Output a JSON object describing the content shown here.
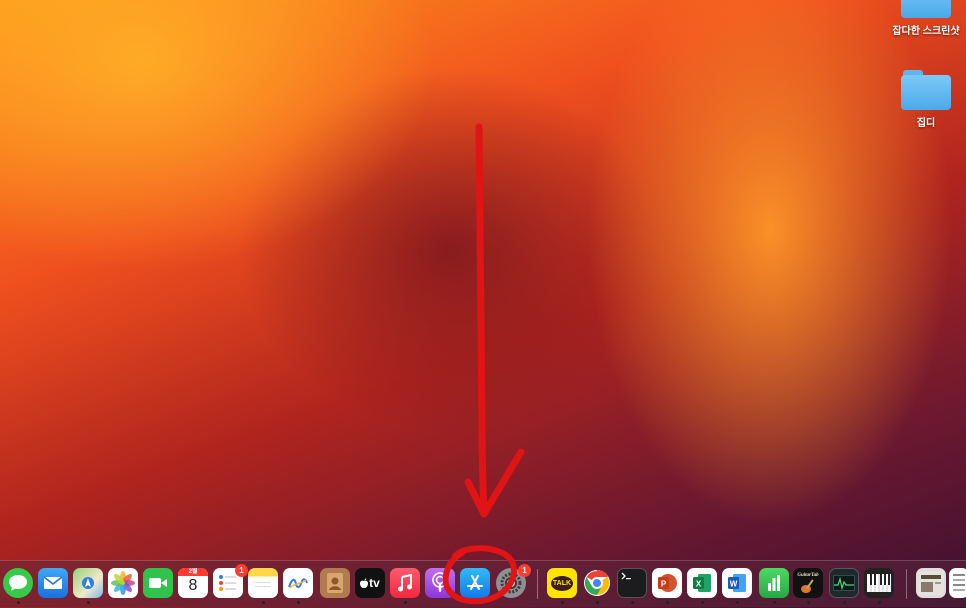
{
  "desktop": {
    "icons": [
      {
        "label": "잡다한 스크린샷"
      },
      {
        "label": "집디"
      }
    ]
  },
  "dock": {
    "calendar": {
      "month": "2월",
      "day": "8"
    },
    "reminders_badge": "1",
    "settings_badge": "1",
    "tv_label": "tv",
    "kakao_label": "TALK",
    "guitar_label": "GuitarTab"
  },
  "annotation": {
    "color": "#e01414"
  }
}
